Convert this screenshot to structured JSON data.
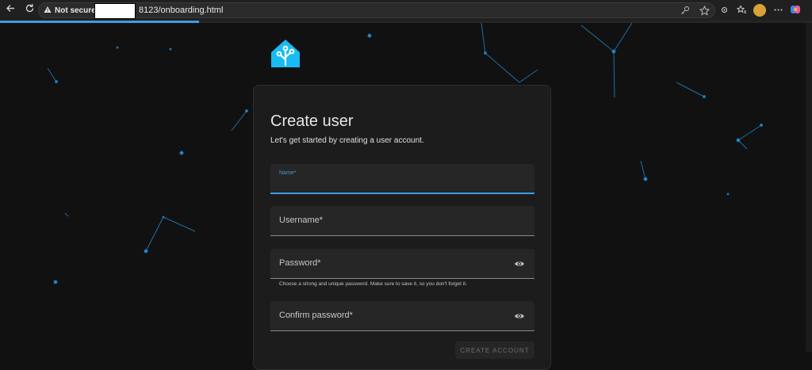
{
  "browser": {
    "security_label": "Not secure",
    "url": "8123/onboarding.html",
    "progress_fraction": 0.245
  },
  "card": {
    "title": "Create user",
    "subtitle": "Let's get started by creating a user account.",
    "fields": {
      "name": {
        "label": "Name*"
      },
      "username": {
        "label": "Username*"
      },
      "password": {
        "label": "Password*",
        "helper": "Choose a strong and unique password. Make sure to save it, so you don't forget it."
      },
      "confirm_password": {
        "label": "Confirm password*"
      }
    },
    "submit_label": "CREATE ACCOUNT"
  },
  "colors": {
    "accent": "#3b9de0",
    "background": "#111111",
    "card": "#1c1c1c"
  }
}
